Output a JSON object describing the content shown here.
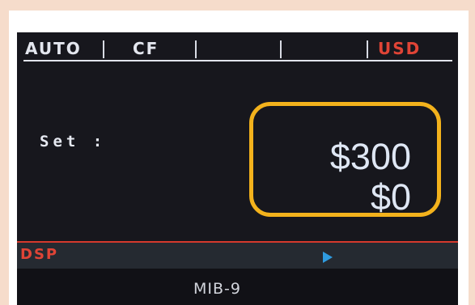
{
  "status_bar": {
    "mode": "AUTO",
    "function": "CF",
    "currency": "USD"
  },
  "main": {
    "set_label": "Set :",
    "amount_primary": "$300",
    "amount_secondary": "$0"
  },
  "display_bar": {
    "label": "DSP",
    "indicator_icon": "play-icon"
  },
  "footer": {
    "model": "MIB-9"
  },
  "colors": {
    "background": "#f6dccb",
    "screen": "#17171d",
    "highlight": "#f3b21c",
    "alert_red": "#e04436",
    "indicator_blue": "#2f9bdf"
  }
}
